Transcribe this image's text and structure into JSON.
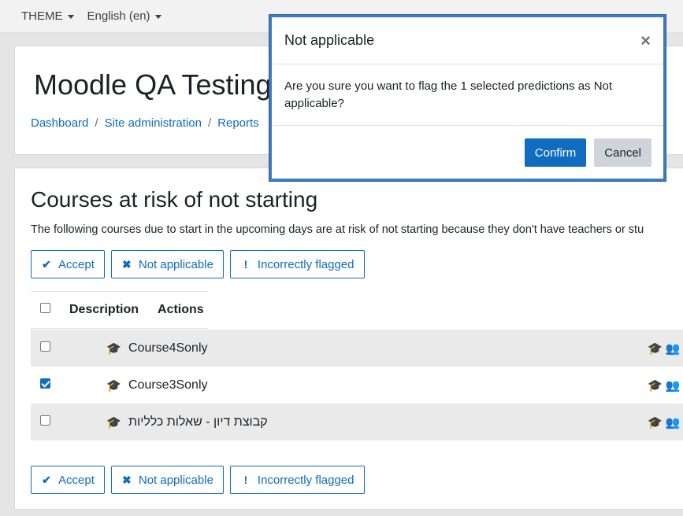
{
  "topbar": {
    "theme_label": "THEME",
    "language_label": "English (en)"
  },
  "page_header": {
    "site_title": "Moodle QA Testing",
    "breadcrumb": [
      "Dashboard",
      "Site administration",
      "Reports"
    ],
    "separator": "/"
  },
  "main": {
    "heading": "Courses at risk of not starting",
    "intro": "The following courses due to start in the upcoming days are at risk of not starting because they don't have teachers or stu",
    "bulk_actions": {
      "accept": "Accept",
      "not_applicable": "Not applicable",
      "incorrectly_flagged": "Incorrectly flagged"
    },
    "table": {
      "headers": [
        "Description",
        "Actions"
      ],
      "rows": [
        {
          "name": "Course4Sonly",
          "checked": false
        },
        {
          "name": "Course3Sonly",
          "checked": true
        },
        {
          "name": "קבוצת דיון - שאלות כלליות",
          "checked": false
        }
      ]
    }
  },
  "modal": {
    "title": "Not applicable",
    "close_glyph": "×",
    "body": "Are you sure you want to flag the 1 selected predictions as Not applicable?",
    "confirm_label": "Confirm",
    "cancel_label": "Cancel"
  },
  "colors": {
    "primary": "#0f6cbf",
    "modal_border": "#3e7cc1",
    "secondary_button": "#ced4da"
  }
}
